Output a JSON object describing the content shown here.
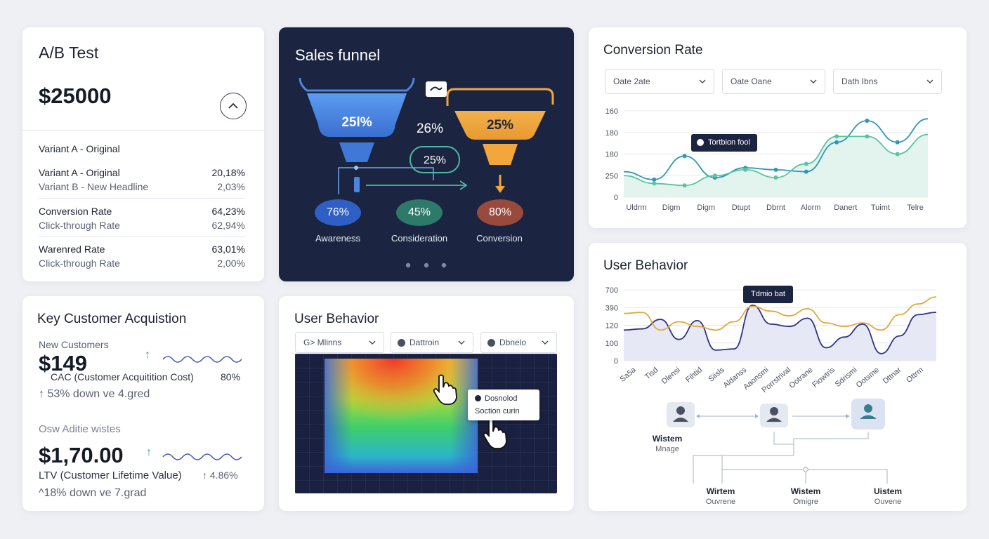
{
  "ab_test": {
    "title": "A/B Test",
    "amount": "$25000",
    "section_label": "Variant A - Original",
    "rows": [
      {
        "label": "Variant A - Original",
        "value": "20,18%"
      },
      {
        "label": "Variant B - New Headline",
        "value": "2,03%"
      },
      {
        "label": "Conversion Rate",
        "value": "64,23%"
      },
      {
        "label": "Click-through Rate",
        "value": "62,94%"
      },
      {
        "label": "Warenred Rate",
        "value": "63,01%"
      },
      {
        "label": "Click-through Rate",
        "value": "2,00%"
      }
    ]
  },
  "funnel": {
    "title": "Sales funnel",
    "left_top_pct": "25l%",
    "middle_pct": "26%",
    "middle_pill_pct": "25%",
    "right_top_pct": "25%",
    "stages": [
      {
        "label": "Awareness",
        "value": "76%",
        "color": "#2f5fc4"
      },
      {
        "label": "Consideration",
        "value": "45%",
        "color": "#2e7a6a"
      },
      {
        "label": "Conversion",
        "value": "80%",
        "color": "#9a4a3c"
      }
    ],
    "colors": {
      "blue": "#4a86e0",
      "orange": "#f2a63c"
    }
  },
  "conversion": {
    "title": "Conversion Rate",
    "selects": [
      "Oate 2ate",
      "Oate Oane",
      "Dath Ibns"
    ],
    "y_ticks": [
      "160",
      "180",
      "180",
      "250",
      "0"
    ],
    "x_ticks": [
      "Uldrm",
      "Digm",
      "Digm",
      "Dtupt",
      "Dbrnt",
      "Alorm",
      "Danert",
      "Tuimt",
      "Telre"
    ],
    "tooltip": "Tortbion fool",
    "series": [
      {
        "color": "#2e97b8",
        "values": [
          4.1,
          3.7,
          4.9,
          3.8,
          4.3,
          4.2,
          4.1,
          5.6,
          6.7,
          5.6,
          6.8
        ]
      },
      {
        "color": "#58c4a1",
        "values": [
          3.9,
          3.5,
          3.4,
          3.9,
          4.2,
          3.8,
          4.5,
          5.9,
          5.9,
          5.0,
          6.0
        ]
      }
    ],
    "y_range": [
      2.8,
      7.2
    ]
  },
  "kca": {
    "title": "Key Customer Acquistion",
    "new_customers_label": "New Customers",
    "value1": "$149",
    "cac_label": "CAC  (Customer Acquitition Cost)",
    "cac_pct": "80%",
    "trend1": "↑ 53% down ve 4.gred",
    "second_label": "Osw Aditie wistes",
    "value2": "$1,70.00",
    "ltv_label": "LTV (Customer Lifetime Value)",
    "ltv_pct": "↑ 4.86%",
    "trend2": "^18% down ve 7.grad",
    "accent": "#2bb07a"
  },
  "heat": {
    "title": "User Behavior",
    "selects": [
      "G> Mlinns",
      "Dattroin",
      "Dbnelo"
    ],
    "tooltip_line1": "Dosnolod",
    "tooltip_line2": "Soction curin"
  },
  "ub": {
    "title": "User Behavior",
    "y_ticks": [
      "700",
      "390",
      "120",
      "100",
      "0"
    ],
    "x_ticks": [
      "Sa5a",
      "Tisd",
      "Dlensi",
      "Fihtid",
      "Siisls",
      "Aldanss",
      "Aaonsmi",
      "Porrstrival",
      "Ootrane",
      "Fiowtris",
      "Sdrismi",
      "Ootsme",
      "Dttnar",
      "Ottrm"
    ],
    "tooltip": "Tdmio bat",
    "series": [
      {
        "color": "#2f3480",
        "values": [
          2.6,
          2.7,
          3.5,
          1.8,
          3.4,
          0.9,
          1.0,
          4.7,
          3.1,
          2.9,
          3.6,
          1.1,
          2.0,
          3.1,
          0.6,
          2.1,
          3.9,
          4.1
        ]
      },
      {
        "color": "#e4a73b",
        "values": [
          4.0,
          4.1,
          2.6,
          3.3,
          2.9,
          2.6,
          3.3,
          4.6,
          4.2,
          3.8,
          4.4,
          3.2,
          2.9,
          3.2,
          2.6,
          3.9,
          4.8,
          5.4
        ]
      }
    ],
    "y_range": [
      0,
      6
    ],
    "nodes": [
      {
        "name": "Wistem",
        "sub": "Mnage"
      },
      {
        "name": "Wirtem",
        "sub": "Ouvrene"
      },
      {
        "name": "Wistem",
        "sub": "Omigre"
      },
      {
        "name": "Uistem",
        "sub": "Ouvene"
      }
    ]
  }
}
